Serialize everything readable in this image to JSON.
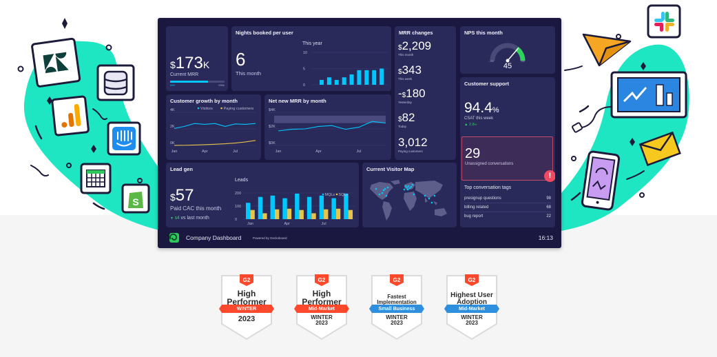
{
  "dashboard": {
    "mrr": {
      "currency": "$",
      "value": "173",
      "suffix": "K",
      "label": "Current MRR",
      "progress": 0.69,
      "bar_left_label": "69%",
      "bar_right_label": "+250k"
    },
    "nights": {
      "title": "Nights booked per user",
      "value": "6",
      "label": "This month",
      "chart_title": "This year",
      "y_ticks": [
        "10",
        "5",
        "0"
      ],
      "values": [
        1.5,
        2.3,
        1.5,
        2.3,
        3.2,
        4.5,
        4.5,
        4.5,
        5.0
      ]
    },
    "mrr_changes": {
      "title": "MRR changes",
      "items": [
        {
          "prefix": "",
          "currency": "$",
          "value": "2,209",
          "label": "This month"
        },
        {
          "prefix": "",
          "currency": "$",
          "value": "343",
          "label": "This week"
        },
        {
          "prefix": "-",
          "currency": "$",
          "value": "180",
          "label": "Yesterday"
        },
        {
          "prefix": "",
          "currency": "$",
          "value": "82",
          "label": "Today"
        },
        {
          "prefix": "",
          "currency": "",
          "value": "3,012",
          "label": "Paying customers"
        }
      ]
    },
    "nps": {
      "title": "NPS this month",
      "value": "45",
      "min_label": "-100",
      "max_label": "100",
      "score": 45
    },
    "customer_growth": {
      "title": "Customer growth by month",
      "legend": [
        "Visitors",
        "Paying customers"
      ],
      "y_ticks": [
        "4K",
        "2K",
        "0K"
      ],
      "x_ticks": [
        "Jan",
        "Apr",
        "Jul"
      ],
      "visitors": [
        2050,
        2300,
        2650,
        2550,
        2650,
        2300,
        2600,
        2550,
        2650
      ],
      "paying": [
        0,
        20,
        50,
        90,
        140,
        200,
        290,
        420,
        600
      ]
    },
    "net_new_mrr": {
      "title": "Net new MRR by month",
      "y_ticks": [
        "$4K",
        "$2K",
        "$0K"
      ],
      "x_ticks": [
        "Jan",
        "Apr",
        "Jul"
      ],
      "values": [
        1750,
        1950,
        2000,
        2300,
        2400,
        1950,
        2200,
        2900,
        2700
      ],
      "target_band": [
        2700,
        3600
      ]
    },
    "customer_support": {
      "title": "Customer support",
      "csat": "94.4",
      "csat_unit": "%",
      "csat_label": "CSAT this week",
      "csat_change": "2.8",
      "csat_change_unit": "%",
      "unassigned": "29",
      "unassigned_label": "Unassigned conversations",
      "tags_title": "Top conversation tags",
      "tags": [
        {
          "name": "presignup questions",
          "count": "98"
        },
        {
          "name": "billing related",
          "count": "68"
        },
        {
          "name": "bug report",
          "count": "22"
        }
      ]
    },
    "lead_gen": {
      "title": "Lead gen",
      "currency": "$",
      "value": "57",
      "label": "Paid CAC this month",
      "change_currency": "$",
      "change_value": "4",
      "change_label": "vs last month",
      "chart_title": "Leads",
      "legend": [
        "MQLs",
        "SQLs"
      ],
      "y_ticks": [
        "200",
        "100",
        "0"
      ],
      "x_ticks": [
        "Jan",
        "Apr",
        "Jul"
      ],
      "mqls": [
        125,
        170,
        180,
        160,
        195,
        170,
        180,
        160,
        195
      ],
      "sqls": [
        70,
        45,
        75,
        80,
        70,
        45,
        75,
        80,
        70
      ]
    },
    "visitor_map": {
      "title": "Current Visitor Map"
    },
    "footer": {
      "title": "Company Dashboard",
      "powered": "Powered by Geckoboard",
      "time": "16:13"
    }
  },
  "badges": [
    {
      "logo": "G2",
      "lines": [
        "High",
        "Performer"
      ],
      "ribbon": "WINTER",
      "footer": [
        "2023"
      ],
      "ribbon_color": "#ff492c"
    },
    {
      "logo": "G2",
      "lines": [
        "High",
        "Performer"
      ],
      "ribbon": "Mid-Market",
      "footer": [
        "WINTER",
        "2023"
      ],
      "ribbon_color": "#ff492c"
    },
    {
      "logo": "G2",
      "lines": [
        "Fastest",
        "Implementation"
      ],
      "ribbon": "Small Business",
      "footer": [
        "WINTER",
        "2023"
      ],
      "ribbon_color": "#2d8fdd"
    },
    {
      "logo": "G2",
      "lines": [
        "Highest User",
        "Adoption"
      ],
      "ribbon": "Mid-Market",
      "footer": [
        "WINTER",
        "2023"
      ],
      "ribbon_color": "#2d8fdd"
    }
  ],
  "colors": {
    "accent_cyan": "#00c8ff",
    "accent_yellow": "#e8c44a",
    "positive": "#2fd25a",
    "alert": "#ef4a62",
    "teal_blob": "#1ee6c3",
    "dash_bg": "#1a1741",
    "card_bg": "#2a2a5a"
  }
}
